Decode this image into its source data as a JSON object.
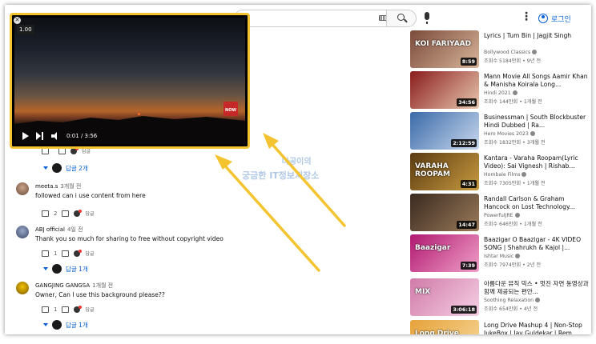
{
  "header": {
    "login_label": "로그인"
  },
  "player": {
    "speed": "1.00",
    "time": "0:01 / 3:56",
    "badge": "NOW"
  },
  "comments": {
    "top_replies": "답글 2개",
    "items": [
      {
        "author": "meeta.s",
        "when": "3개월 전",
        "text": "followed can i use content from here",
        "likes": "",
        "reply": "답글"
      },
      {
        "author": "ABJ official",
        "when": "4일 전",
        "text": "Thank you so much for sharing to free without copyright video",
        "likes": "1",
        "reply": "답글",
        "replies": "답글 1개"
      },
      {
        "author": "GANGJING GANGSA",
        "when": "1개월 전",
        "text": "Owner, Can I use this background please??",
        "likes": "1",
        "reply": "답글",
        "replies": "답글 1개"
      }
    ],
    "first_likes": "",
    "first_reply": "답글",
    "meeta_likes": "2"
  },
  "watermark": {
    "line1": "나공이의",
    "line2": "궁금한 IT정보저장소"
  },
  "sidebar": {
    "videos": [
      {
        "title": "Lyrics | Tum Bin | Jagjit Singh",
        "channel": "Bollywood Classics",
        "meta": "조회수 5184만회 • 9년 전",
        "duration": "8:59",
        "thumb_text": "KOI FARIYAAD",
        "colors": [
          "#7a4a3a",
          "#d8b59a"
        ]
      },
      {
        "title": "Mann Movie All Songs Aamir Khan & Manisha Koirala Long...",
        "channel": "Hindi 2021",
        "meta": "조회수 144만회 • 1개월 전",
        "duration": "34:56",
        "thumb_text": "",
        "colors": [
          "#8a1c1c",
          "#e8c8b0"
        ]
      },
      {
        "title": "Businessman | South Blockbuster Hindi Dubbed | Ra...",
        "channel": "Hero Movies 2023",
        "meta": "조회수 1832만회 • 3개월 전",
        "duration": "2:12:59",
        "thumb_text": "",
        "colors": [
          "#3a6aa8",
          "#c9d8ee"
        ]
      },
      {
        "title": "Kantara - Varaha Roopam(Lyric Video): Sai Vignesh | Rishab...",
        "channel": "Hombale Films",
        "meta": "조회수 7305만회 • 1개월 전",
        "duration": "4:31",
        "thumb_text": "VARAHA ROOPAM",
        "colors": [
          "#5a3a10",
          "#c89a40"
        ]
      },
      {
        "title": "Randall Carlson & Graham Hancock on Lost Technology...",
        "channel": "PowerfulJRE",
        "meta": "조회수 646만회 • 1개월 전",
        "duration": "14:47",
        "thumb_text": "",
        "colors": [
          "#3a2a20",
          "#9a7a5a"
        ]
      },
      {
        "title": "Baazigar O Baazigar - 4K VIDEO SONG | Shahrukh & Kajol |...",
        "channel": "Ishtar Music",
        "meta": "조회수 7974만회 • 2년 전",
        "duration": "7:39",
        "thumb_text": "Baazigar",
        "colors": [
          "#b01870",
          "#f0a0c8"
        ]
      },
      {
        "title": "아름다운 뮤직 믹스 • 멋진 자연 동영상과 함께 제공되는 편안...",
        "channel": "Soothing Relaxation",
        "meta": "조회수 654만회 • 4년 전",
        "duration": "3:06:18",
        "thumb_text": "MIX",
        "colors": [
          "#d07aa8",
          "#f6d0e4"
        ]
      },
      {
        "title": "Long Drive Mashup 4 | Non-Stop JukeBox | Jay Guldekar | Rem...",
        "channel": "",
        "meta": "",
        "duration": "",
        "thumb_text": "Long Drive",
        "colors": [
          "#e6a23a",
          "#f6d89a"
        ]
      }
    ]
  }
}
